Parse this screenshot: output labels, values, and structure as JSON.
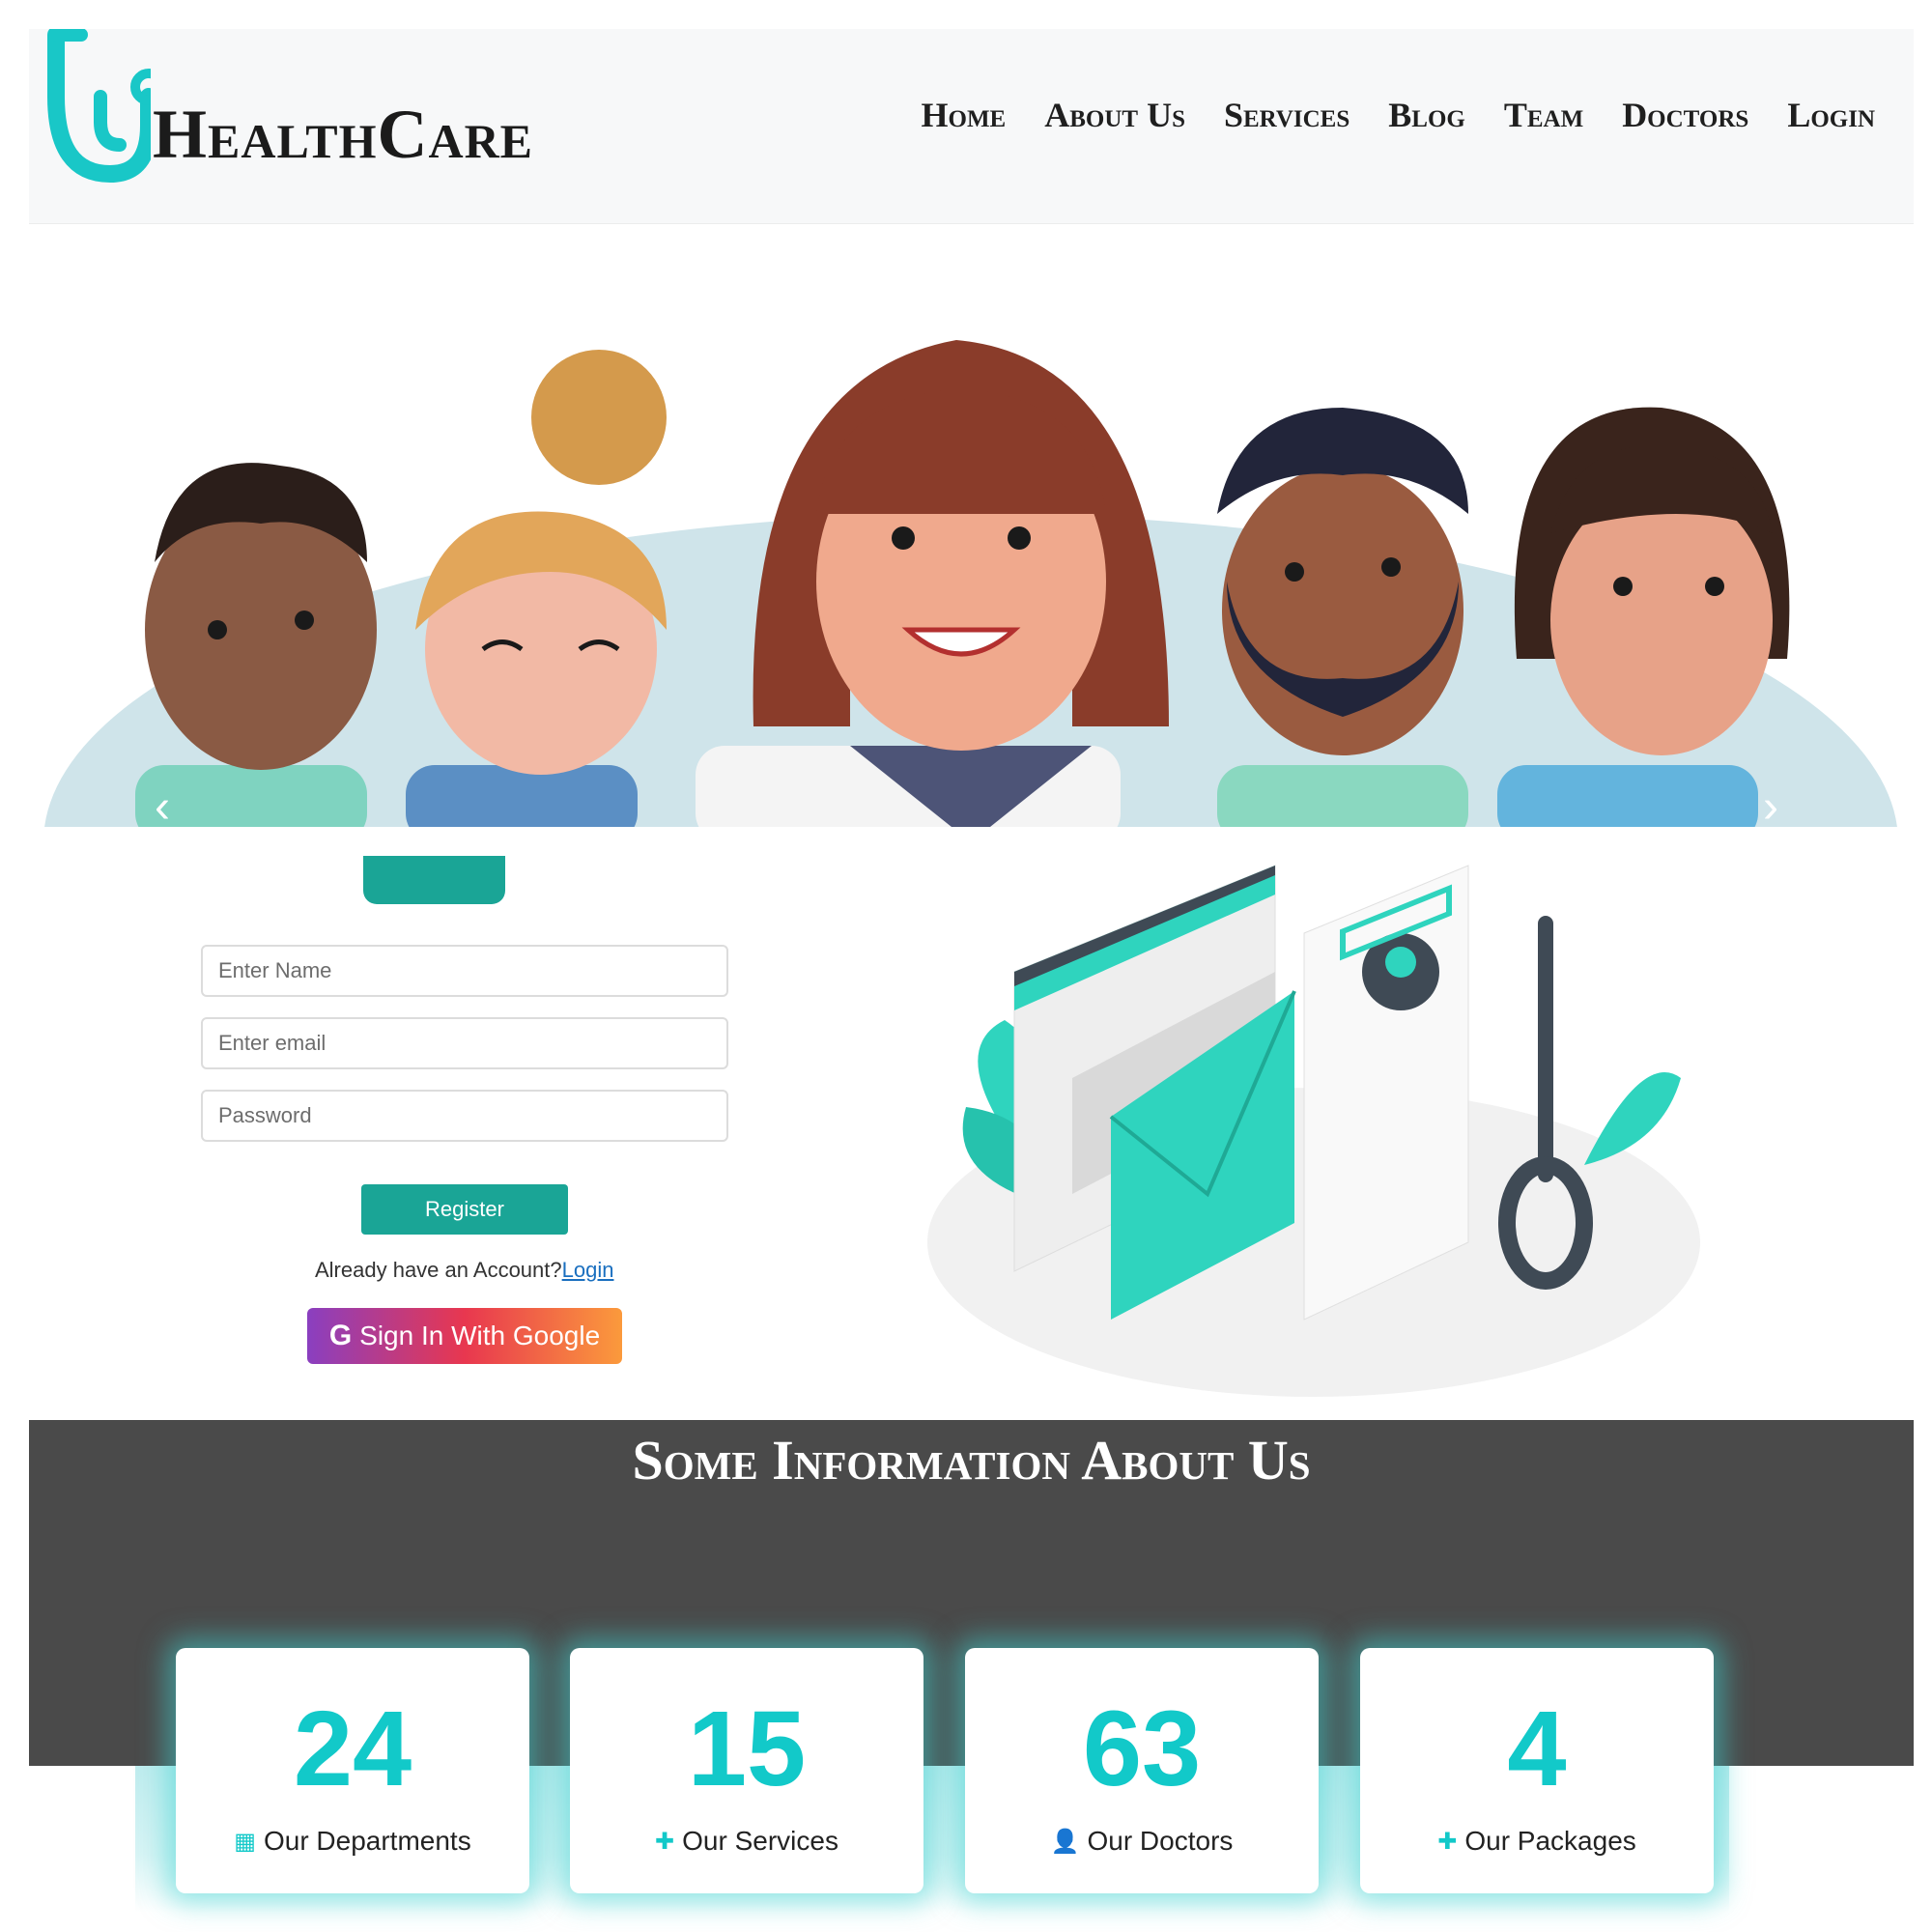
{
  "header": {
    "brand": "HealthCare",
    "nav": [
      "Home",
      "About Us",
      "Services",
      "Blog",
      "Team",
      "Doctors",
      "Login"
    ]
  },
  "hero": {
    "prev_icon": "chevron-left-icon",
    "next_icon": "chevron-right-icon",
    "prev_glyph": "‹",
    "next_glyph": "›"
  },
  "register": {
    "name_placeholder": "Enter Name",
    "email_placeholder": "Enter email",
    "password_placeholder": "Password",
    "register_label": "Register",
    "already_text": "Already have an Account?",
    "login_link": "Login",
    "google_label": "Sign In With Google",
    "google_glyph": "G"
  },
  "info": {
    "title": "Some Information About Us",
    "cards": [
      {
        "number": "24",
        "label": "Our Departments",
        "icon": "hospital-icon",
        "glyph": "▦"
      },
      {
        "number": "15",
        "label": "Our Services",
        "icon": "hand-medical-icon",
        "glyph": "✚"
      },
      {
        "number": "63",
        "label": "Our Doctors",
        "icon": "doctor-icon",
        "glyph": "👤"
      },
      {
        "number": "4",
        "label": "Our Packages",
        "icon": "briefcase-medical-icon",
        "glyph": "✚"
      }
    ]
  },
  "colors": {
    "accent": "#1aa596",
    "stat": "#12c9c9",
    "dark_band": "#4a4a4a",
    "logo": "#19c7c7"
  }
}
